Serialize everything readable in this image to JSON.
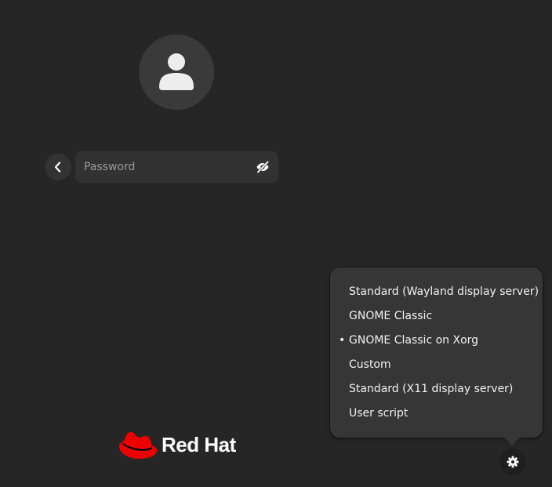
{
  "login": {
    "avatar_icon": "user-avatar-icon",
    "back_icon": "chevron-left-icon",
    "password_placeholder": "Password",
    "password_value": "",
    "reveal_icon": "eye-crossed-icon"
  },
  "session_menu": {
    "items": [
      {
        "label": "Standard (Wayland display server)",
        "selected": false
      },
      {
        "label": "GNOME Classic",
        "selected": false
      },
      {
        "label": "GNOME Classic on Xorg",
        "selected": true
      },
      {
        "label": "Custom",
        "selected": false
      },
      {
        "label": "Standard (X11 display server)",
        "selected": false
      },
      {
        "label": "User script",
        "selected": false
      }
    ],
    "bullet": "•"
  },
  "footer": {
    "brand_name": "Red Hat",
    "brand_icon": "red-hat-logo-icon",
    "settings_icon": "gear-icon"
  },
  "colors": {
    "background": "#262626",
    "brand_red": "#ee0000",
    "menu_bg": "#363636"
  }
}
